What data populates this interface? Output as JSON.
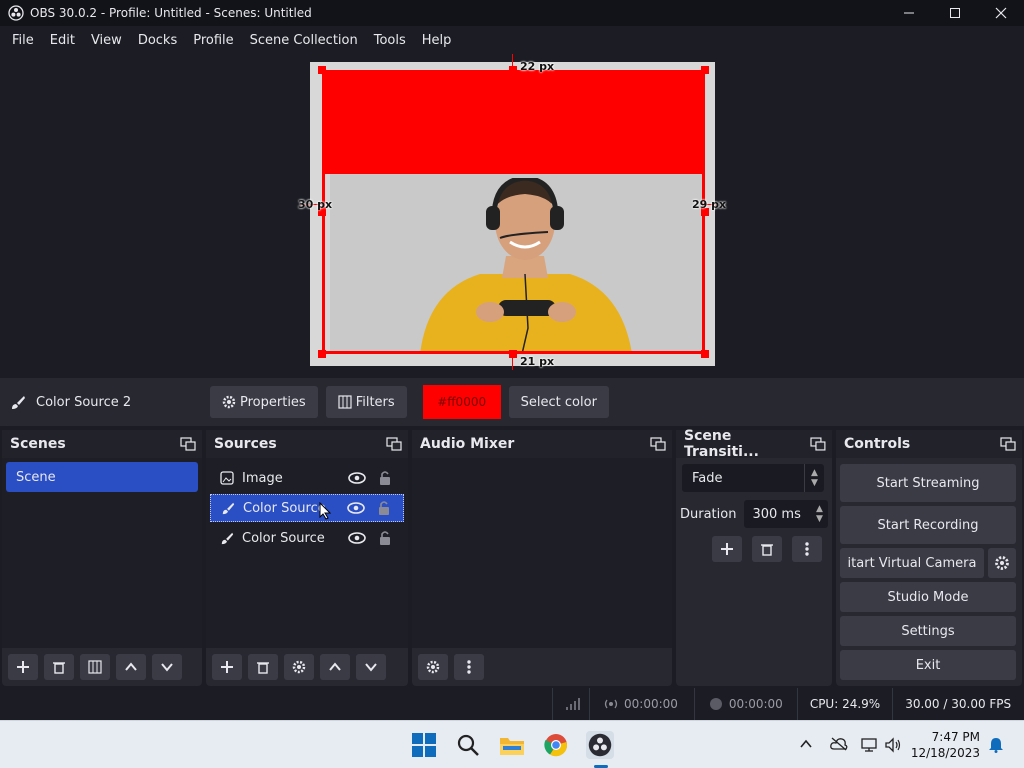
{
  "window": {
    "title": "OBS 30.0.2 - Profile: Untitled - Scenes: Untitled"
  },
  "menu": [
    "File",
    "Edit",
    "View",
    "Docks",
    "Profile",
    "Scene Collection",
    "Tools",
    "Help"
  ],
  "preview": {
    "top_label": "22 px",
    "left_label": "30 px",
    "right_label": "29 px",
    "bottom_label": "21 px",
    "fill_color": "#ff0000"
  },
  "source_toolbar": {
    "selected_source": "Color Source 2",
    "properties": "Properties",
    "filters": "Filters",
    "color_value": "#ff0000",
    "select_color": "Select color"
  },
  "scenes": {
    "title": "Scenes",
    "items": [
      "Scene"
    ]
  },
  "sources": {
    "title": "Sources",
    "items": [
      {
        "label": "Image",
        "icon": "image-icon",
        "selected": false
      },
      {
        "label": "Color Source",
        "icon": "brush-icon",
        "selected": true
      },
      {
        "label": "Color Source",
        "icon": "brush-icon",
        "selected": false
      }
    ]
  },
  "audio_mixer": {
    "title": "Audio Mixer"
  },
  "transitions": {
    "title": "Scene Transiti...",
    "selected": "Fade",
    "duration_label": "Duration",
    "duration_value": "300 ms"
  },
  "controls": {
    "title": "Controls",
    "start_streaming": "Start Streaming",
    "start_recording": "Start Recording",
    "start_virtual_camera": "itart Virtual Camera",
    "studio_mode": "Studio Mode",
    "settings": "Settings",
    "exit": "Exit"
  },
  "status": {
    "stream_time": "00:00:00",
    "record_time": "00:00:00",
    "cpu": "CPU: 24.9%",
    "fps": "30.00 / 30.00 FPS"
  },
  "taskbar": {
    "time": "7:47 PM",
    "date": "12/18/2023"
  },
  "colors": {
    "accent": "#2a4fc4",
    "panel": "#272830",
    "background": "#1c1d24"
  }
}
